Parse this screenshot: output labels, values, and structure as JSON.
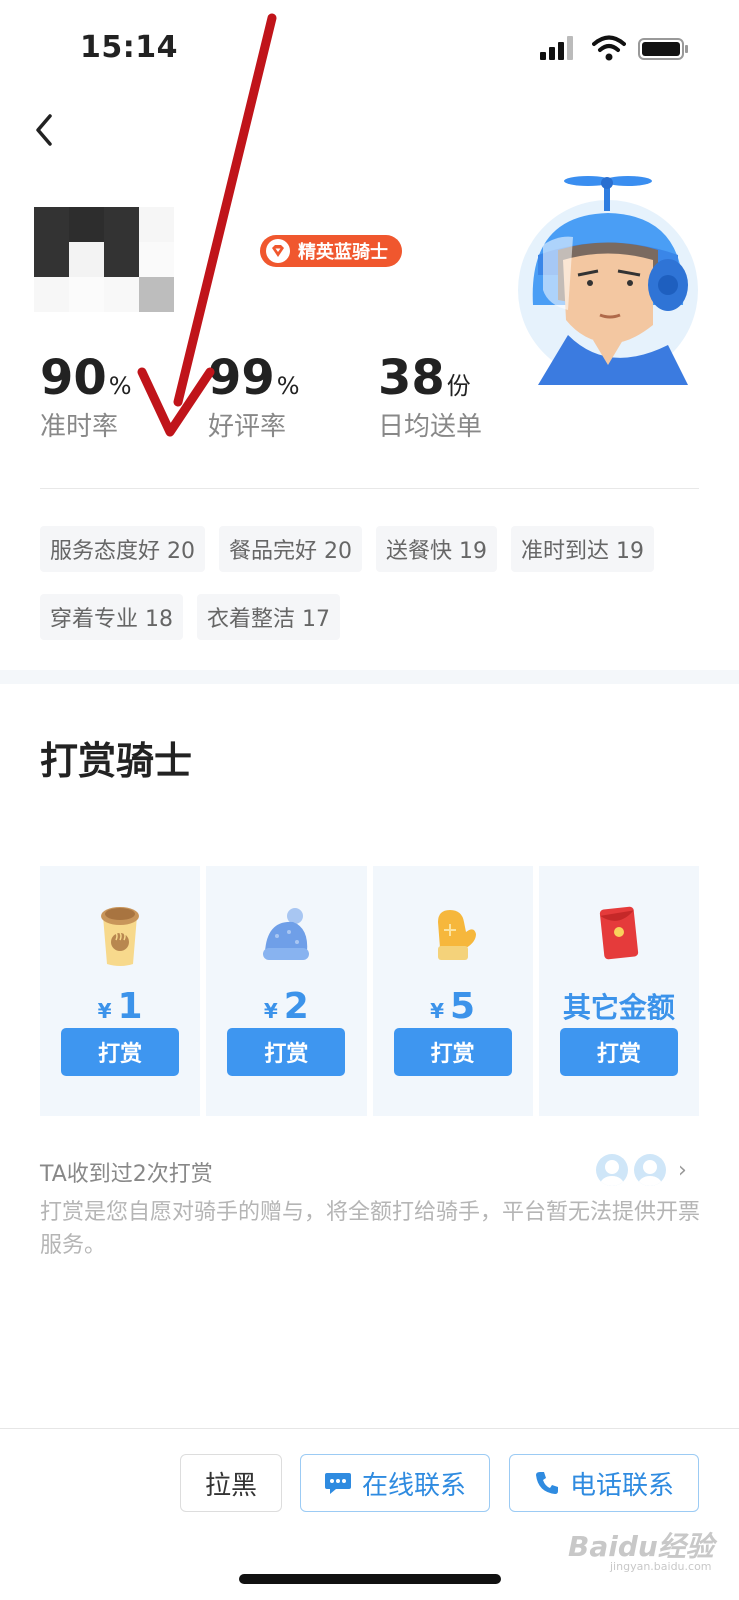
{
  "status_bar": {
    "time": "15:14"
  },
  "rider": {
    "badge": "精英蓝骑士",
    "stats": [
      {
        "value": "90",
        "unit": "%",
        "label": "准时率"
      },
      {
        "value": "99",
        "unit": "%",
        "label": "好评率"
      },
      {
        "value": "38",
        "unit": "份",
        "label": "日均送单"
      }
    ],
    "tags": [
      "服务态度好 20",
      "餐品完好 20",
      "送餐快 19",
      "准时到达 19",
      "穿着专业 18",
      "衣着整洁 17"
    ]
  },
  "reward": {
    "title": "打赏骑士",
    "options": [
      {
        "icon": "coffee-icon",
        "currency": "¥",
        "amount": "1",
        "button": "打赏"
      },
      {
        "icon": "knit-hat-icon",
        "currency": "¥",
        "amount": "2",
        "button": "打赏"
      },
      {
        "icon": "mitten-icon",
        "currency": "¥",
        "amount": "5",
        "button": "打赏"
      },
      {
        "icon": "red-envelope-icon",
        "currency": "",
        "amount": "其它金额",
        "button": "打赏"
      }
    ],
    "received": "TA收到过2次打赏",
    "note": "打赏是您自愿对骑手的赠与，将全额打给骑手，平台暂无法提供开票服务。"
  },
  "bottom_bar": {
    "block": "拉黑",
    "online": "在线联系",
    "phone": "电话联系"
  },
  "watermark": {
    "main": "Baidu经验",
    "sub": "jingyan.baidu.com"
  },
  "colors": {
    "accent": "#3e96f0",
    "badge": "#f0572e",
    "annotation_arrow": "#c0141a"
  }
}
